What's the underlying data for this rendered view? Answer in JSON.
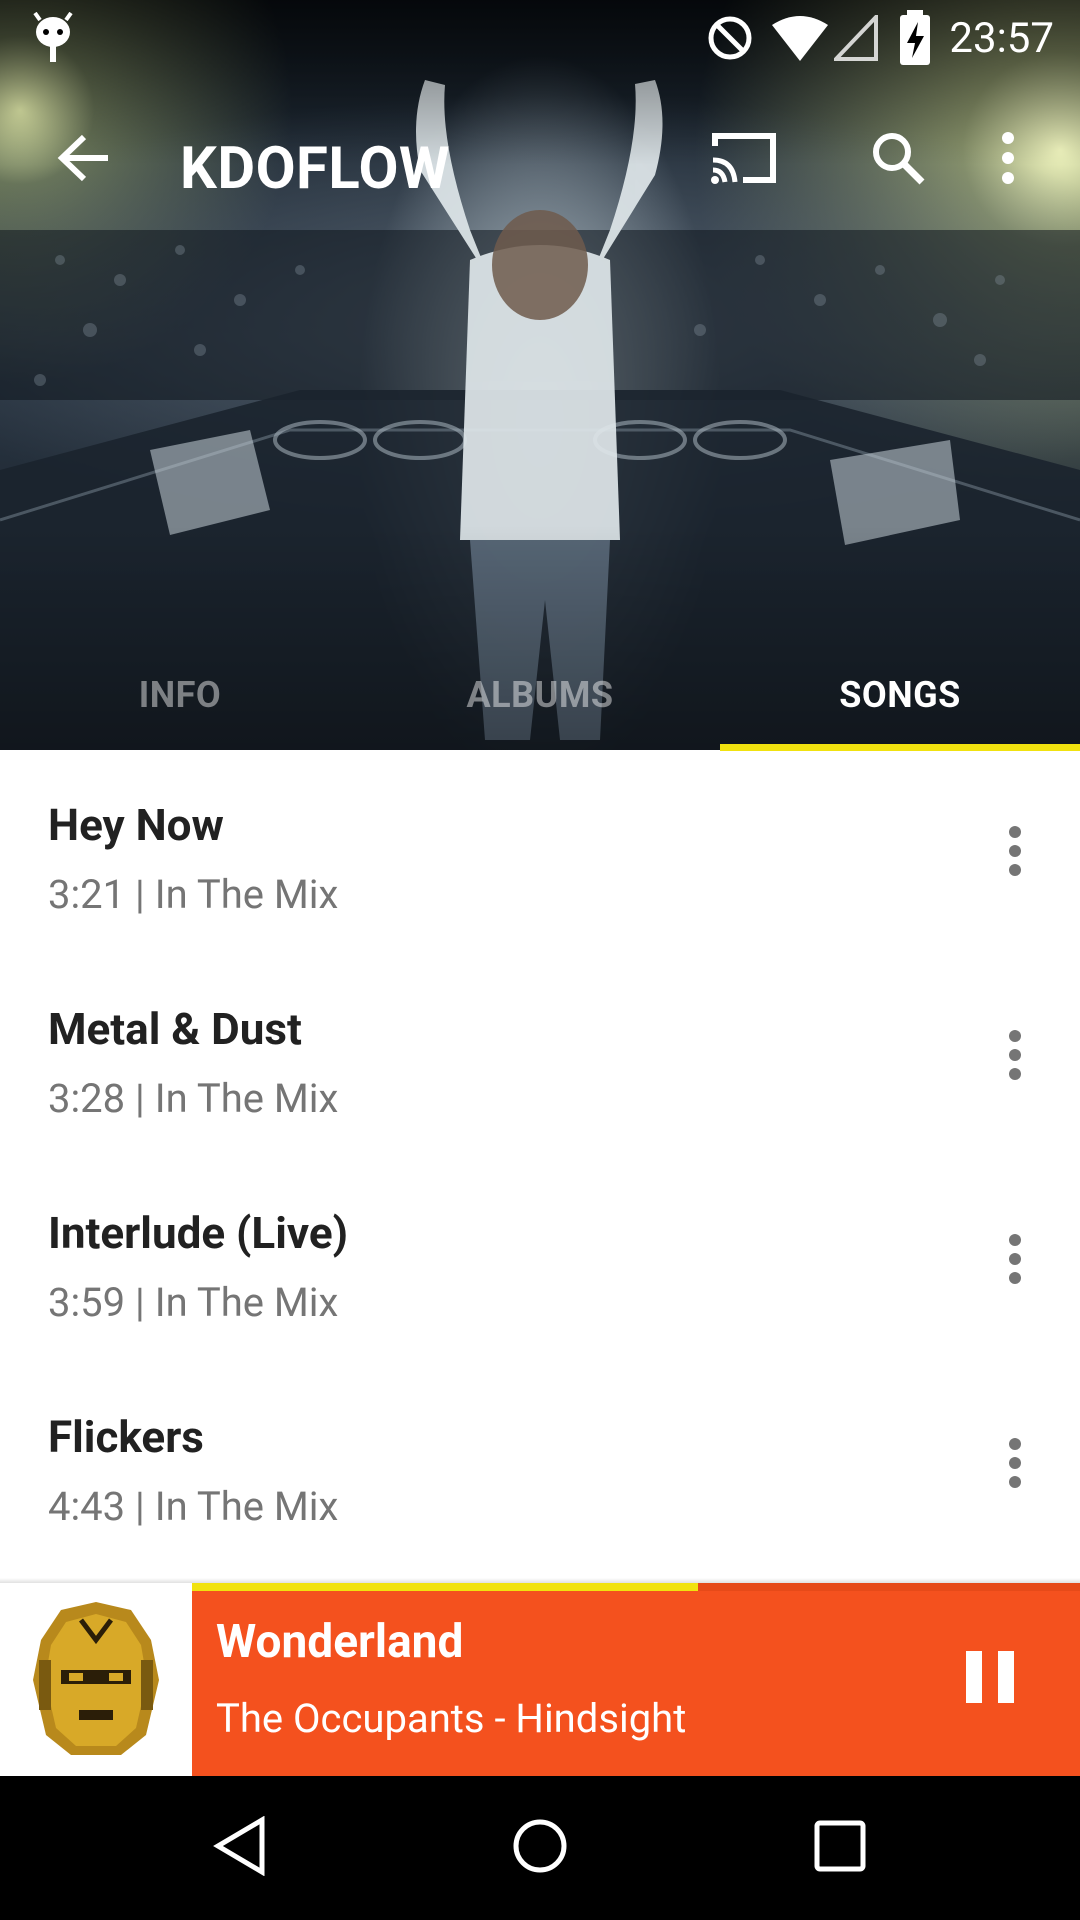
{
  "status_bar": {
    "time": "23:57",
    "icons": [
      "android-debug-icon",
      "do-not-disturb-icon",
      "wifi-icon",
      "cell-signal-icon",
      "battery-charging-icon"
    ]
  },
  "toolbar": {
    "title": "KDOFLOW",
    "back_icon": "arrow-back-icon",
    "cast_icon": "cast-icon",
    "search_icon": "search-icon",
    "overflow_icon": "more-vert-icon"
  },
  "tabs": [
    {
      "label": "INFO",
      "active": false
    },
    {
      "label": "ALBUMS",
      "active": false
    },
    {
      "label": "SONGS",
      "active": true
    }
  ],
  "songs": [
    {
      "title": "Hey Now",
      "meta": "3:21 | In The Mix"
    },
    {
      "title": "Metal & Dust",
      "meta": "3:28 | In The Mix"
    },
    {
      "title": "Interlude (Live)",
      "meta": "3:59 | In The Mix"
    },
    {
      "title": "Flickers",
      "meta": "4:43 | In The Mix"
    }
  ],
  "now_playing": {
    "title": "Wonderland",
    "subtitle": "The Occupants - Hindsight",
    "progress": 0.57,
    "state_icon": "pause-icon"
  },
  "navigation": {
    "back": "nav-back-icon",
    "home": "nav-home-icon",
    "recents": "nav-recents-icon"
  },
  "colors": {
    "accent": "#f1e20f",
    "now_playing_bg": "#f4511e",
    "text_primary": "#212121",
    "text_secondary": "#757575"
  }
}
